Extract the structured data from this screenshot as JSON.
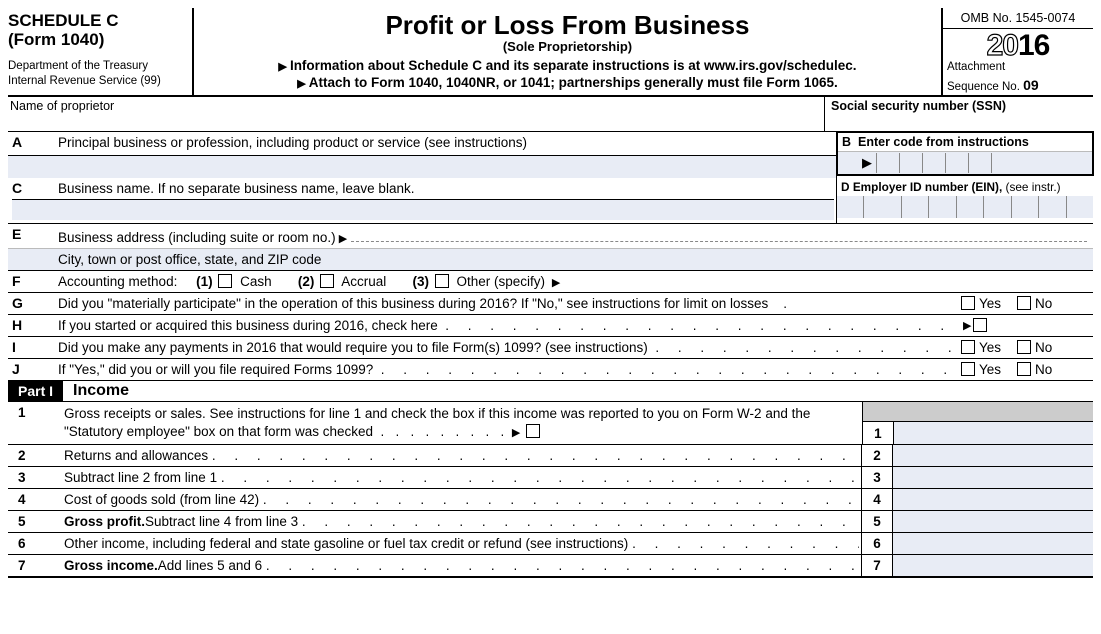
{
  "header": {
    "schedule": "SCHEDULE C",
    "form": "(Form 1040)",
    "dept": "Department of the Treasury",
    "irs": "Internal Revenue Service (99)",
    "title": "Profit or Loss From Business",
    "subtitle": "(Sole Proprietorship)",
    "info_line": "Information about Schedule C and its separate instructions is at www.irs.gov/schedulec.",
    "attach_line": "Attach to Form 1040, 1040NR, or 1041; partnerships generally must file Form 1065.",
    "omb": "OMB No. 1545-0074",
    "year_outline": "20",
    "year_solid": "16",
    "attachment": "Attachment",
    "sequence": "Sequence No.",
    "seq_num": "09"
  },
  "section1": {
    "proprietor_label": "Name of proprietor",
    "ssn_label": "Social security number (SSN)"
  },
  "lines": {
    "A": "Principal business or profession, including product or service (see instructions)",
    "B_label": "B",
    "B_text": "Enter code from instructions",
    "C": "Business name. If no separate business name, leave blank.",
    "D_label": "D",
    "D_text": "Employer ID number (EIN),",
    "D_suffix": " (see instr.)",
    "E1": "Business address (including suite or room no.)",
    "E2": "City, town or post office, state, and ZIP code",
    "F_label": "Accounting method:",
    "F1_num": "(1)",
    "F1": "Cash",
    "F2_num": "(2)",
    "F2": "Accrual",
    "F3_num": "(3)",
    "F3": "Other (specify)",
    "G": "Did you \"materially participate\" in the operation of this business during 2016? If \"No,\" see instructions for limit on losses",
    "H": "If you started or acquired this business during 2016, check here",
    "I": "Did you make any payments in 2016 that would require you to file Form(s) 1099? (see instructions)",
    "J": "If \"Yes,\" did you or will you file required Forms 1099?",
    "yes": "Yes",
    "no": "No"
  },
  "part1": {
    "part": "Part I",
    "title": "Income",
    "line1": "Gross receipts or sales. See instructions for line 1 and check the box if this income was reported to you on Form W-2 and the \"Statutory employee\" box on that form was checked",
    "line2": "Returns and allowances",
    "line3": "Subtract line 2 from line 1",
    "line4": "Cost of goods sold (from line 42)",
    "line5a": "Gross profit.",
    "line5b": " Subtract line 4 from line 3",
    "line6": "Other income, including federal and state gasoline or fuel tax credit or refund (see instructions)",
    "line7a": "Gross income.",
    "line7b": " Add lines 5 and 6",
    "n1": "1",
    "n2": "2",
    "n3": "3",
    "n4": "4",
    "n5": "5",
    "n6": "6",
    "n7": "7"
  }
}
